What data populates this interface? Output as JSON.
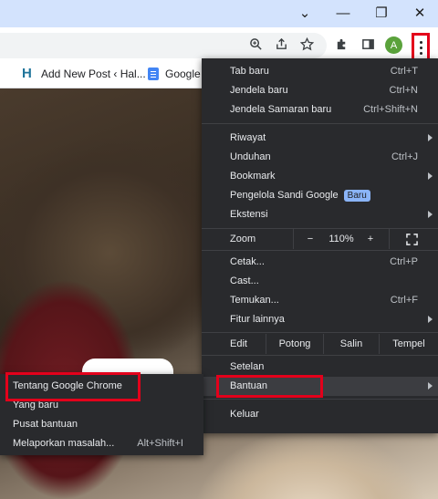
{
  "window": {
    "controls": [
      "⌄",
      "—",
      "❐",
      "✕"
    ]
  },
  "toolbar": {
    "avatar_letter": "A"
  },
  "bookmarks": [
    {
      "label": "Add New Post ‹ Hal...",
      "icon": "h-icon"
    },
    {
      "label": "Google",
      "icon": "docs-icon"
    }
  ],
  "menu": {
    "items1": [
      {
        "label": "Tab baru",
        "shortcut": "Ctrl+T"
      },
      {
        "label": "Jendela baru",
        "shortcut": "Ctrl+N"
      },
      {
        "label": "Jendela Samaran baru",
        "shortcut": "Ctrl+Shift+N"
      }
    ],
    "items2": [
      {
        "label": "Riwayat",
        "shortcut": ""
      },
      {
        "label": "Unduhan",
        "shortcut": "Ctrl+J"
      },
      {
        "label": "Bookmark",
        "shortcut": ""
      },
      {
        "label": "Pengelola Sandi Google",
        "shortcut": "",
        "badge": "Baru"
      },
      {
        "label": "Ekstensi",
        "shortcut": ""
      }
    ],
    "zoom": {
      "label": "Zoom",
      "minus": "−",
      "value": "110%",
      "plus": "+",
      "fullscreen_icon": "fullscreen-icon"
    },
    "items3": [
      {
        "label": "Cetak...",
        "shortcut": "Ctrl+P"
      },
      {
        "label": "Cast...",
        "shortcut": ""
      },
      {
        "label": "Temukan...",
        "shortcut": "Ctrl+F"
      },
      {
        "label": "Fitur lainnya",
        "shortcut": ""
      }
    ],
    "edit": {
      "label": "Edit",
      "cut": "Potong",
      "copy": "Salin",
      "paste": "Tempel"
    },
    "settings": "Setelan",
    "help": "Bantuan",
    "exit": "Keluar"
  },
  "submenu": {
    "items": [
      {
        "label": "Tentang Google Chrome",
        "shortcut": ""
      },
      {
        "label": "Yang baru",
        "shortcut": ""
      },
      {
        "label": "Pusat bantuan",
        "shortcut": ""
      },
      {
        "label": "Melaporkan masalah...",
        "shortcut": "Alt+Shift+I"
      }
    ]
  },
  "colors": {
    "menu_bg": "#292a2d",
    "highlight_box": "#e3001b",
    "badge": "#8ab4f8"
  }
}
